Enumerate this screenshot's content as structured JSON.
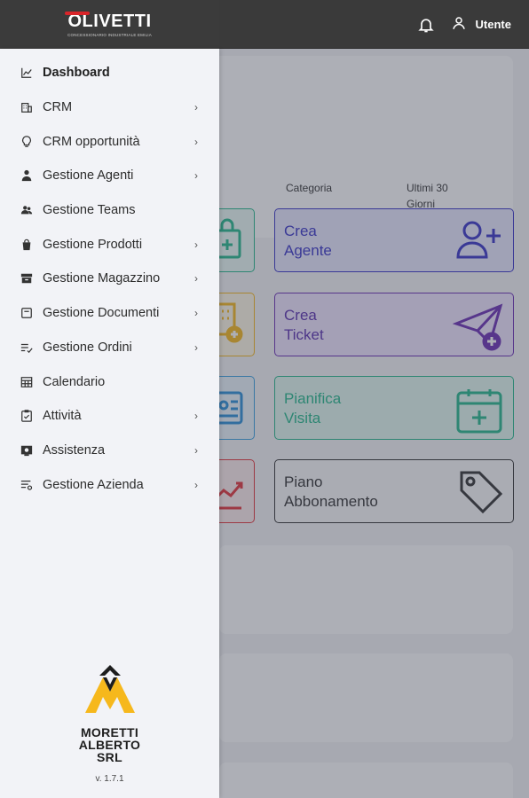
{
  "header": {
    "brand": "OLIVETTI",
    "brand_tagline": "CONCESSIONARIO INDUSTRIALE EMILIA",
    "user_label": "Utente"
  },
  "filters": {
    "category": "Categoria",
    "last_30_line1": "Ultimi 30",
    "last_30_line2": "Giorni"
  },
  "tiles": [
    {
      "line1": "Crea",
      "line2": "Agente",
      "color": "#3a35c9",
      "icon": "user-add-icon"
    },
    {
      "line1": "Crea",
      "line2": "Ticket",
      "color": "#6b2fb5",
      "icon": "paper-plane-add-icon"
    },
    {
      "line1": "Pianifica",
      "line2": "Visita",
      "color": "#25b98c",
      "icon": "calendar-add-icon"
    },
    {
      "line1": "Piano",
      "line2": "Abbonamento",
      "color": "#333333",
      "icon": "tag-icon"
    }
  ],
  "sidebar": {
    "items": [
      {
        "label": "Dashboard",
        "icon": "chart-line-icon",
        "chevron": false,
        "active": true
      },
      {
        "label": "CRM",
        "icon": "building-icon",
        "chevron": true
      },
      {
        "label": "CRM opportunità",
        "icon": "lightbulb-icon",
        "chevron": true
      },
      {
        "label": "Gestione Agenti",
        "icon": "agents-icon",
        "chevron": true
      },
      {
        "label": "Gestione Teams",
        "icon": "team-icon",
        "chevron": false
      },
      {
        "label": "Gestione Prodotti",
        "icon": "shopping-bag-icon",
        "chevron": true
      },
      {
        "label": "Gestione Magazzino",
        "icon": "warehouse-icon",
        "chevron": true
      },
      {
        "label": "Gestione Documenti",
        "icon": "document-icon",
        "chevron": true
      },
      {
        "label": "Gestione Ordini",
        "icon": "order-list-icon",
        "chevron": true
      },
      {
        "label": "Calendario",
        "icon": "calendar-grid-icon",
        "chevron": false
      },
      {
        "label": "Attività",
        "icon": "checklist-icon",
        "chevron": true
      },
      {
        "label": "Assistenza",
        "icon": "support-icon",
        "chevron": true
      },
      {
        "label": "Gestione Azienda",
        "icon": "settings-list-icon",
        "chevron": true
      }
    ],
    "chevron_glyph": "›"
  },
  "company": {
    "line1": "MORETTI",
    "line2": "ALBERTO",
    "line3": "SRL",
    "version": "v. 1.7.1"
  },
  "colors": {
    "accent_yellow": "#f6b81c",
    "topbar": "#3a3a3a",
    "brand_red": "#d9252a"
  }
}
